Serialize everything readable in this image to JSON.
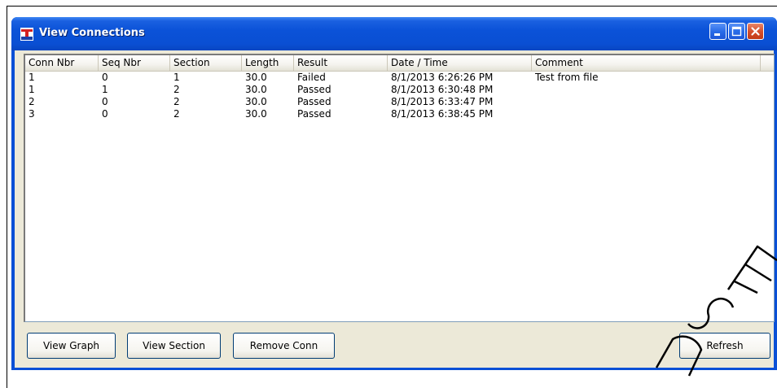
{
  "window": {
    "title": "View Connections"
  },
  "columns": [
    "Conn Nbr",
    "Seq Nbr",
    "Section",
    "Length",
    "Result",
    "Date / Time",
    "Comment"
  ],
  "rows": [
    [
      "1",
      "0",
      "1",
      "30.0",
      "Failed",
      "8/1/2013 6:26:26 PM",
      "Test from file"
    ],
    [
      "1",
      "1",
      "2",
      "30.0",
      "Passed",
      "8/1/2013 6:30:48 PM",
      ""
    ],
    [
      "2",
      "0",
      "2",
      "30.0",
      "Passed",
      "8/1/2013 6:33:47 PM",
      ""
    ],
    [
      "3",
      "0",
      "2",
      "30.0",
      "Passed",
      "8/1/2013 6:38:45 PM",
      ""
    ]
  ],
  "buttons": {
    "view_graph": "View Graph",
    "view_section": "View Section",
    "remove_conn": "Remove Conn",
    "refresh": "Refresh"
  },
  "icons": {
    "app": "app-logo-icon",
    "minimize": "minimize-icon",
    "maximize": "maximize-icon",
    "close": "close-icon"
  },
  "colors": {
    "titlebar": "#0a50d6",
    "close_button": "#c23a16",
    "dialog_face": "#ece9d8"
  }
}
